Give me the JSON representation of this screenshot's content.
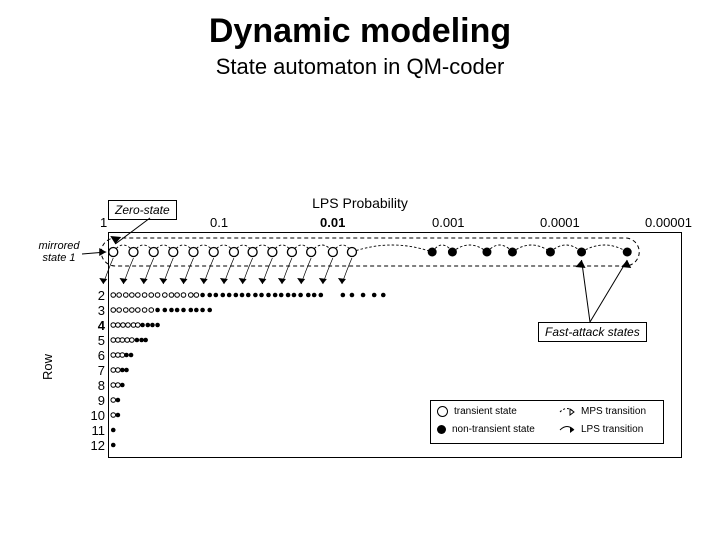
{
  "title": "Dynamic modeling",
  "subtitle": "State automaton in QM-coder",
  "axis": {
    "top_title": "LPS Probability",
    "left_title": "Row",
    "x_ticks": [
      "1",
      "0.1",
      "0.01",
      "0.001",
      "0.0001",
      "0.00001"
    ],
    "y_ticks": [
      "2",
      "3",
      "4",
      "5",
      "6",
      "7",
      "8",
      "9",
      "10",
      "11",
      "12"
    ]
  },
  "callouts": {
    "zero_state": "Zero-state",
    "fast_attack": "Fast-attack states",
    "mirrored_line1": "mirrored",
    "mirrored_line2": "state 1"
  },
  "legend": {
    "open_state": "transient state",
    "filled_state": "non-transient state",
    "mps": "MPS transition",
    "lps": "LPS transition"
  },
  "chart_data": {
    "type": "scatter",
    "title": "State automaton in QM-coder",
    "xlabel": "LPS Probability",
    "ylabel": "Row",
    "x_scale": "log",
    "x_ticks": [
      1,
      0.1,
      0.01,
      0.001,
      0.0001,
      1e-05
    ],
    "y_ticks": [
      1,
      2,
      3,
      4,
      5,
      6,
      7,
      8,
      9,
      10,
      11,
      12
    ],
    "note": "Row 1 shown in a dashed capsule; positions approximate on log-x axis. 'open' = transient state (hollow circle), 'filled' = non-transient state (solid circle). Row 1 also shows dashed MPS transition arcs from each state to its lower-probability neighbor.",
    "series": [
      {
        "name": "Row 1",
        "row": 1,
        "points": [
          {
            "x": 0.9,
            "kind": "open"
          },
          {
            "x": 0.6,
            "kind": "open"
          },
          {
            "x": 0.4,
            "kind": "open"
          },
          {
            "x": 0.27,
            "kind": "open"
          },
          {
            "x": 0.18,
            "kind": "open"
          },
          {
            "x": 0.12,
            "kind": "open"
          },
          {
            "x": 0.08,
            "kind": "open"
          },
          {
            "x": 0.055,
            "kind": "open"
          },
          {
            "x": 0.037,
            "kind": "open"
          },
          {
            "x": 0.025,
            "kind": "open"
          },
          {
            "x": 0.017,
            "kind": "open"
          },
          {
            "x": 0.011,
            "kind": "open"
          },
          {
            "x": 0.0075,
            "kind": "open"
          },
          {
            "x": 0.0015,
            "kind": "filled"
          },
          {
            "x": 0.001,
            "kind": "filled"
          },
          {
            "x": 0.0005,
            "kind": "filled"
          },
          {
            "x": 0.0003,
            "kind": "filled"
          },
          {
            "x": 0.00014,
            "kind": "filled"
          },
          {
            "x": 7.5e-05,
            "kind": "filled"
          },
          {
            "x": 3e-05,
            "kind": "filled"
          }
        ]
      },
      {
        "name": "Row 2",
        "row": 2,
        "points": [
          {
            "x": 0.9,
            "kind": "open"
          },
          {
            "x": 0.8,
            "kind": "open"
          },
          {
            "x": 0.7,
            "kind": "open"
          },
          {
            "x": 0.62,
            "kind": "open"
          },
          {
            "x": 0.55,
            "kind": "open"
          },
          {
            "x": 0.48,
            "kind": "open"
          },
          {
            "x": 0.42,
            "kind": "open"
          },
          {
            "x": 0.37,
            "kind": "open"
          },
          {
            "x": 0.32,
            "kind": "open"
          },
          {
            "x": 0.28,
            "kind": "open"
          },
          {
            "x": 0.25,
            "kind": "open"
          },
          {
            "x": 0.22,
            "kind": "open"
          },
          {
            "x": 0.19,
            "kind": "open"
          },
          {
            "x": 0.17,
            "kind": "open"
          },
          {
            "x": 0.15,
            "kind": "filled"
          },
          {
            "x": 0.13,
            "kind": "filled"
          },
          {
            "x": 0.115,
            "kind": "filled"
          },
          {
            "x": 0.1,
            "kind": "filled"
          },
          {
            "x": 0.088,
            "kind": "filled"
          },
          {
            "x": 0.077,
            "kind": "filled"
          },
          {
            "x": 0.068,
            "kind": "filled"
          },
          {
            "x": 0.06,
            "kind": "filled"
          },
          {
            "x": 0.052,
            "kind": "filled"
          },
          {
            "x": 0.046,
            "kind": "filled"
          },
          {
            "x": 0.04,
            "kind": "filled"
          },
          {
            "x": 0.035,
            "kind": "filled"
          },
          {
            "x": 0.031,
            "kind": "filled"
          },
          {
            "x": 0.027,
            "kind": "filled"
          },
          {
            "x": 0.024,
            "kind": "filled"
          },
          {
            "x": 0.021,
            "kind": "filled"
          },
          {
            "x": 0.018,
            "kind": "filled"
          },
          {
            "x": 0.016,
            "kind": "filled"
          },
          {
            "x": 0.014,
            "kind": "filled"
          },
          {
            "x": 0.009,
            "kind": "filled"
          },
          {
            "x": 0.0075,
            "kind": "filled"
          },
          {
            "x": 0.006,
            "kind": "filled"
          },
          {
            "x": 0.0048,
            "kind": "filled"
          },
          {
            "x": 0.004,
            "kind": "filled"
          }
        ]
      },
      {
        "name": "Row 3",
        "row": 3,
        "points": [
          {
            "x": 0.9,
            "kind": "open"
          },
          {
            "x": 0.8,
            "kind": "open"
          },
          {
            "x": 0.7,
            "kind": "open"
          },
          {
            "x": 0.62,
            "kind": "open"
          },
          {
            "x": 0.55,
            "kind": "open"
          },
          {
            "x": 0.48,
            "kind": "open"
          },
          {
            "x": 0.42,
            "kind": "open"
          },
          {
            "x": 0.37,
            "kind": "filled"
          },
          {
            "x": 0.32,
            "kind": "filled"
          },
          {
            "x": 0.28,
            "kind": "filled"
          },
          {
            "x": 0.25,
            "kind": "filled"
          },
          {
            "x": 0.22,
            "kind": "filled"
          },
          {
            "x": 0.19,
            "kind": "filled"
          },
          {
            "x": 0.17,
            "kind": "filled"
          },
          {
            "x": 0.15,
            "kind": "filled"
          },
          {
            "x": 0.13,
            "kind": "filled"
          }
        ]
      },
      {
        "name": "Row 4",
        "row": 4,
        "points": [
          {
            "x": 0.9,
            "kind": "open"
          },
          {
            "x": 0.82,
            "kind": "open"
          },
          {
            "x": 0.74,
            "kind": "open"
          },
          {
            "x": 0.67,
            "kind": "open"
          },
          {
            "x": 0.6,
            "kind": "open"
          },
          {
            "x": 0.55,
            "kind": "open"
          },
          {
            "x": 0.5,
            "kind": "filled"
          },
          {
            "x": 0.45,
            "kind": "filled"
          },
          {
            "x": 0.41,
            "kind": "filled"
          },
          {
            "x": 0.37,
            "kind": "filled"
          }
        ]
      },
      {
        "name": "Row 5",
        "row": 5,
        "points": [
          {
            "x": 0.9,
            "kind": "open"
          },
          {
            "x": 0.82,
            "kind": "open"
          },
          {
            "x": 0.75,
            "kind": "open"
          },
          {
            "x": 0.68,
            "kind": "open"
          },
          {
            "x": 0.62,
            "kind": "open"
          },
          {
            "x": 0.56,
            "kind": "filled"
          },
          {
            "x": 0.51,
            "kind": "filled"
          },
          {
            "x": 0.47,
            "kind": "filled"
          }
        ]
      },
      {
        "name": "Row 6",
        "row": 6,
        "points": [
          {
            "x": 0.9,
            "kind": "open"
          },
          {
            "x": 0.82,
            "kind": "open"
          },
          {
            "x": 0.75,
            "kind": "open"
          },
          {
            "x": 0.69,
            "kind": "filled"
          },
          {
            "x": 0.63,
            "kind": "filled"
          }
        ]
      },
      {
        "name": "Row 7",
        "row": 7,
        "points": [
          {
            "x": 0.9,
            "kind": "open"
          },
          {
            "x": 0.82,
            "kind": "open"
          },
          {
            "x": 0.75,
            "kind": "filled"
          },
          {
            "x": 0.69,
            "kind": "filled"
          }
        ]
      },
      {
        "name": "Row 8",
        "row": 8,
        "points": [
          {
            "x": 0.9,
            "kind": "open"
          },
          {
            "x": 0.82,
            "kind": "open"
          },
          {
            "x": 0.75,
            "kind": "filled"
          }
        ]
      },
      {
        "name": "Row 9",
        "row": 9,
        "points": [
          {
            "x": 0.9,
            "kind": "open"
          },
          {
            "x": 0.82,
            "kind": "filled"
          }
        ]
      },
      {
        "name": "Row 10",
        "row": 10,
        "points": [
          {
            "x": 0.9,
            "kind": "open"
          },
          {
            "x": 0.82,
            "kind": "filled"
          }
        ]
      },
      {
        "name": "Row 11",
        "row": 11,
        "points": [
          {
            "x": 0.9,
            "kind": "filled"
          }
        ]
      },
      {
        "name": "Row 12",
        "row": 12,
        "points": [
          {
            "x": 0.9,
            "kind": "filled"
          }
        ]
      }
    ]
  }
}
